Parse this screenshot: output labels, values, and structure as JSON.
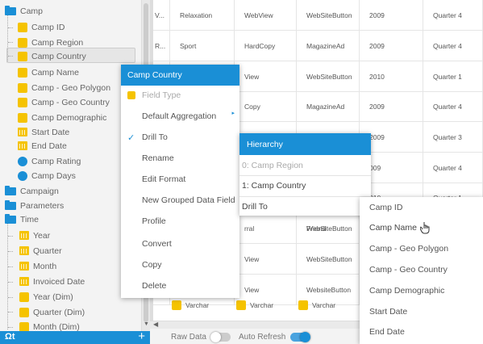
{
  "field_tree": {
    "items": [
      {
        "label": "Camp",
        "icon": "folder-icon"
      },
      {
        "label": "Camp ID",
        "icon": "dimension-icon"
      },
      {
        "label": "Camp Region",
        "icon": "dimension-icon"
      },
      {
        "label": "Camp Country",
        "icon": "dimension-icon"
      },
      {
        "label": "Camp Name",
        "icon": "dimension-icon"
      },
      {
        "label": "Camp - Geo Polygon",
        "icon": "dimension-icon"
      },
      {
        "label": "Camp - Geo Country",
        "icon": "dimension-icon"
      },
      {
        "label": "Camp Demographic",
        "icon": "dimension-icon"
      },
      {
        "label": "Start Date",
        "icon": "calendar-icon"
      },
      {
        "label": "End Date",
        "icon": "calendar-icon"
      },
      {
        "label": "Camp Rating",
        "icon": "metric-icon"
      },
      {
        "label": "Camp Days",
        "icon": "metric-icon"
      },
      {
        "label": "Campaign",
        "icon": "folder-icon"
      },
      {
        "label": "Parameters",
        "icon": "folder-icon"
      },
      {
        "label": "Time",
        "icon": "folder-icon"
      },
      {
        "label": "Year",
        "icon": "calendar-icon"
      },
      {
        "label": "Quarter",
        "icon": "calendar-icon"
      },
      {
        "label": "Month",
        "icon": "calendar-icon"
      },
      {
        "label": "Invoiced Date",
        "icon": "calendar-icon"
      },
      {
        "label": "Year (Dim)",
        "icon": "dimension-icon"
      },
      {
        "label": "Quarter (Dim)",
        "icon": "dimension-icon"
      },
      {
        "label": "Month (Dim)",
        "icon": "dimension-icon"
      }
    ],
    "toolbar_left": "Ωt",
    "toolbar_add": "+"
  },
  "grid": {
    "rows": [
      [
        "V...",
        "Relaxation",
        "WebView",
        "WebSiteButton",
        "2009",
        "Quarter 4"
      ],
      [
        "R...",
        "Sport",
        "HardCopy",
        "MagazineAd",
        "2009",
        "Quarter 4"
      ],
      [
        "",
        "",
        "View",
        "WebSiteButton",
        "2010",
        "Quarter 1"
      ],
      [
        "",
        "",
        "Copy",
        "MagazineAd",
        "2009",
        "Quarter 4"
      ],
      [
        "",
        "",
        "View",
        "WebSiteButton",
        "2009",
        "Quarter 3"
      ],
      [
        "",
        "",
        "",
        "",
        "009",
        "Quarter 4"
      ],
      [
        "",
        "",
        "",
        "",
        "010",
        "Quarter 1"
      ],
      [
        "",
        "",
        "",
        "WebSiteButton",
        "009",
        "Quarter 4"
      ],
      [
        "",
        "",
        "rral",
        "Friend",
        "",
        ""
      ],
      [
        "",
        "",
        "View",
        "WebSiteButton",
        "",
        ""
      ],
      [
        "",
        "",
        "View",
        "WebsiteButton",
        "",
        ""
      ]
    ],
    "datatypes": [
      "Varchar",
      "Varchar",
      "Varchar"
    ]
  },
  "status_bar": {
    "raw_data_label": "Raw Data",
    "raw_data_on": false,
    "auto_refresh_label": "Auto Refresh",
    "auto_refresh_on": true
  },
  "context_menu": {
    "title": "Camp Country",
    "items": [
      {
        "label": "Field Type",
        "disabled": true
      },
      {
        "label": "Default Aggregation",
        "submenu": true
      },
      {
        "label": "Drill To",
        "checked": true,
        "check_mark": "✓"
      },
      {
        "label": "Rename"
      },
      {
        "label": "Edit Format"
      },
      {
        "label": "New Grouped Data Field"
      },
      {
        "label": "Profile"
      },
      {
        "label": "Convert"
      },
      {
        "label": "Copy"
      },
      {
        "label": "Delete"
      }
    ]
  },
  "drill_submenu": {
    "title": "Hierarchy",
    "items": [
      {
        "label": "0: Camp Region",
        "disabled": true
      },
      {
        "label": "1: Camp Country"
      },
      {
        "label": "Drill To"
      }
    ]
  },
  "drill_target_menu": {
    "items": [
      {
        "label": "Camp ID"
      },
      {
        "label": "Camp Name",
        "hovered": true
      },
      {
        "label": "Camp - Geo Polygon"
      },
      {
        "label": "Camp - Geo Country"
      },
      {
        "label": "Camp Demographic"
      },
      {
        "label": "Start Date"
      },
      {
        "label": "End Date"
      }
    ]
  },
  "colors": {
    "accent": "#1a8fd6",
    "dimension": "#f5c300"
  }
}
